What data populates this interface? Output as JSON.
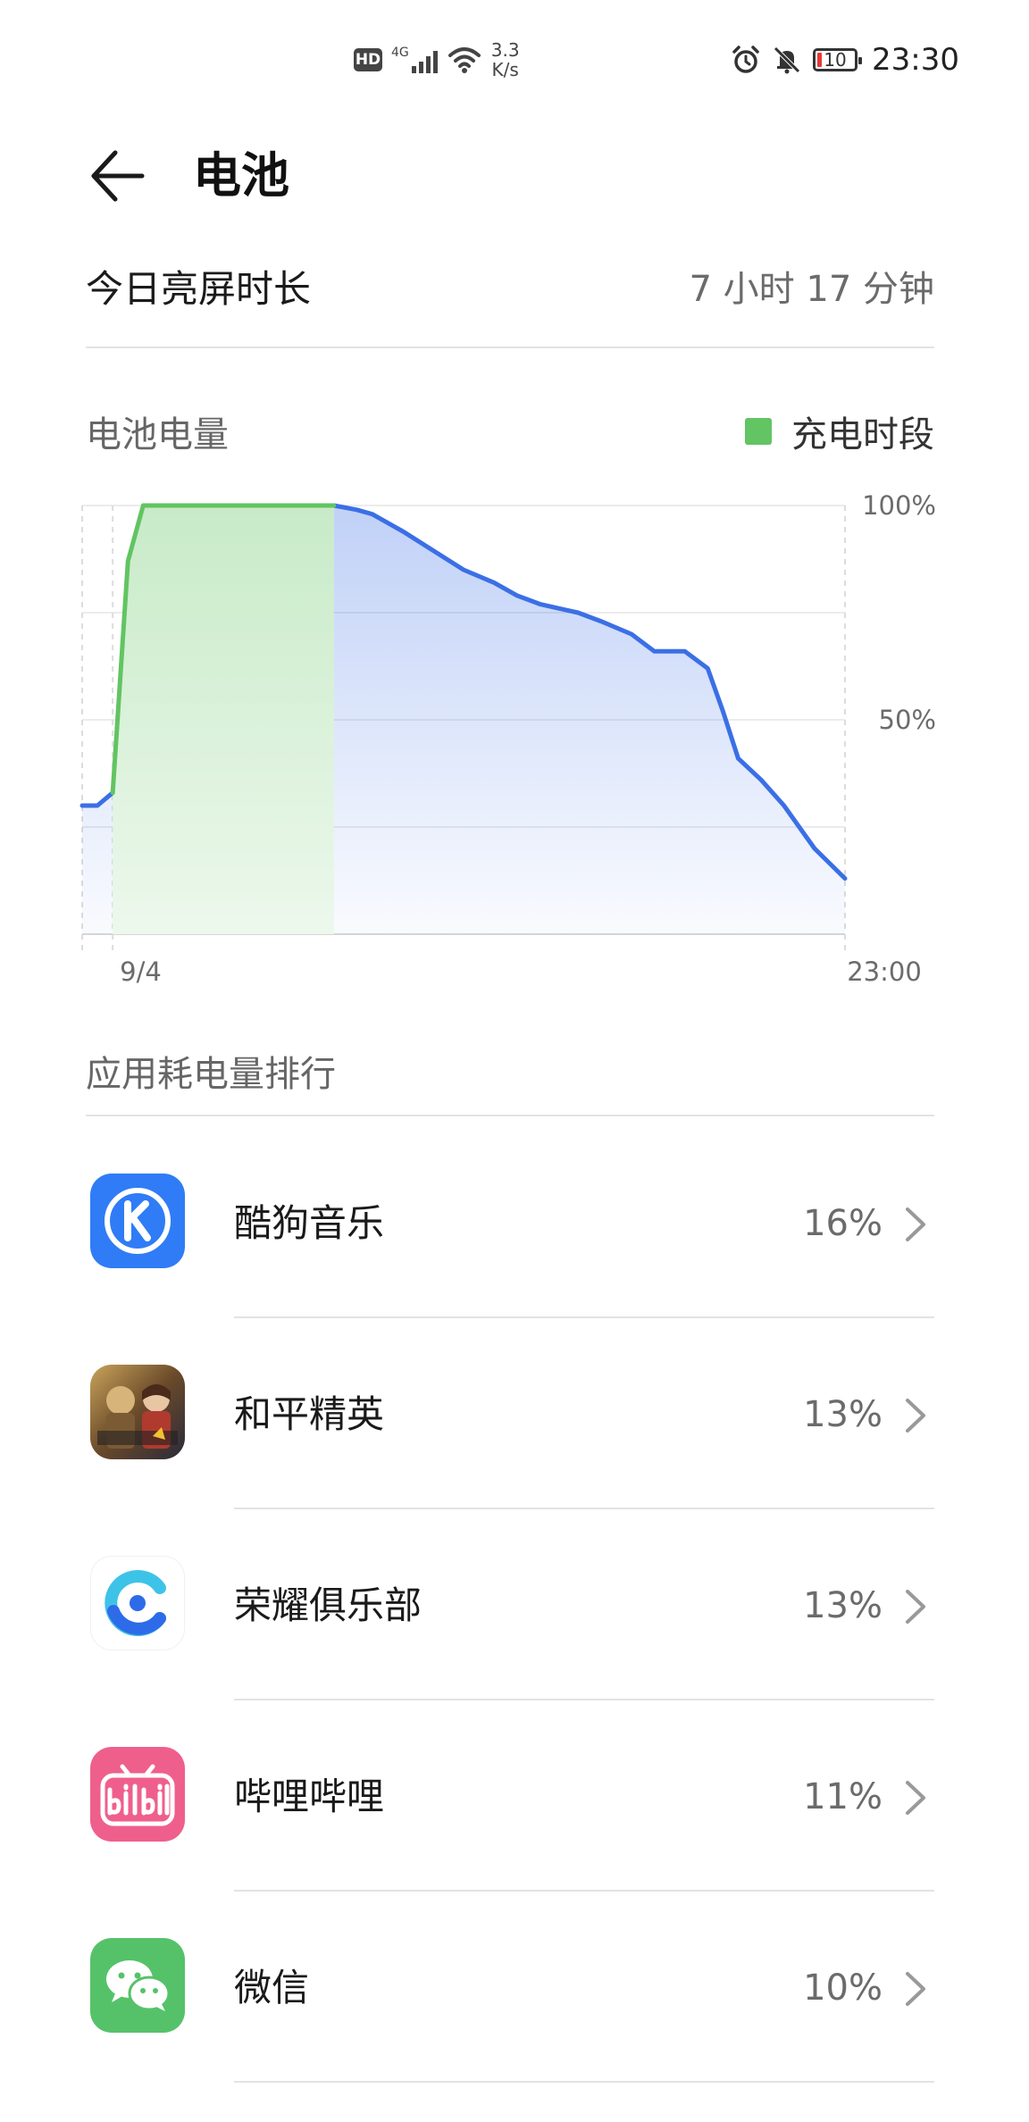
{
  "status_bar": {
    "hd_label": "HD",
    "network_type": "4G",
    "net_speed_value": "3.3",
    "net_speed_unit": "K/s",
    "battery_level": "10",
    "time": "23:30"
  },
  "header": {
    "title": "电池"
  },
  "screen_time": {
    "label": "今日亮屏时长",
    "value": "7 小时 17 分钟"
  },
  "battery_chart": {
    "title": "电池电量",
    "legend_label": "充电时段",
    "colors": {
      "charging": "#62c462",
      "discharging": "#3b6fe6"
    }
  },
  "chart_data": {
    "type": "area",
    "title": "电池电量",
    "y_tick_labels": [
      "100%",
      "50%"
    ],
    "x_tick_labels": [
      "9/4",
      "23:00"
    ],
    "ylim": [
      0,
      100
    ],
    "xlim": [
      0,
      1
    ],
    "grid": true,
    "legend_position": "top-right",
    "series": [
      {
        "name": "充电时段",
        "x": [
          0.04,
          0.06,
          0.08,
          0.33
        ],
        "values": [
          33,
          87,
          100,
          100
        ]
      },
      {
        "x": [
          0.0,
          0.02,
          0.04,
          0.33,
          0.36,
          0.38,
          0.42,
          0.5,
          0.54,
          0.57,
          0.6,
          0.65,
          0.68,
          0.72,
          0.75,
          0.79,
          0.82,
          0.84,
          0.86,
          0.89,
          0.92,
          0.96,
          1.0
        ],
        "values": [
          30,
          30,
          33,
          100,
          99,
          98,
          94,
          85,
          82,
          79,
          77,
          75,
          73,
          70,
          66,
          66,
          62,
          52,
          41,
          36,
          30,
          20,
          13
        ]
      }
    ]
  },
  "ranking": {
    "title": "应用耗电量排行",
    "items": [
      {
        "name": "酷狗音乐",
        "percent": "16%",
        "icon": "kugou-music-icon",
        "color": "#2f7cf6"
      },
      {
        "name": "和平精英",
        "percent": "13%",
        "icon": "peace-elite-icon",
        "color": "#8a6b3a"
      },
      {
        "name": "荣耀俱乐部",
        "percent": "13%",
        "icon": "honor-club-icon",
        "color": "#2d6be8"
      },
      {
        "name": "哔哩哔哩",
        "percent": "11%",
        "icon": "bilibili-icon",
        "color": "#ef5f8c"
      },
      {
        "name": "微信",
        "percent": "10%",
        "icon": "wechat-icon",
        "color": "#55c26a"
      }
    ]
  }
}
